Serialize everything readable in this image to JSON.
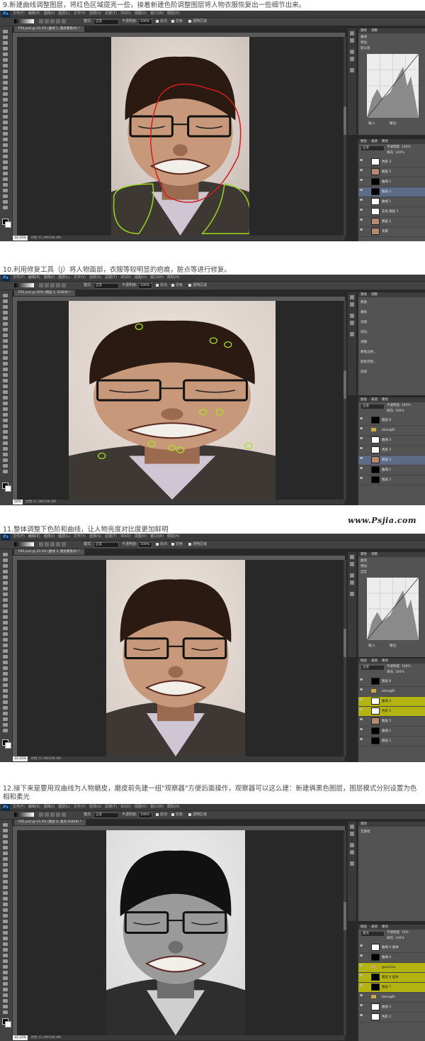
{
  "steps": [
    {
      "caption": "9.新建曲线调整图层，将红色区域提亮一些，接着新建色阶调整图层将人物衣服恢复出一些细节出来。"
    },
    {
      "caption": "10.利用修复工具（J）将人物面部，衣服等较明显的疤痕，脏点等进行修复。"
    },
    {
      "caption": "11.整体调整下色阶和曲线，让人物亮度对比度更加鲜明"
    },
    {
      "caption": "12.接下来是要用双曲线为人物磨皮，磨皮前先建一组\"观察器\"方便后面操作，观察器可以这么建：新建俩黑色图层，图层模式分别设置为色相和柔光"
    }
  ],
  "watermark": "www.Psjia.com",
  "photoshop": {
    "logo": "Ps",
    "options": {
      "mode_label": "模式:",
      "mode_value": "正常",
      "opacity_label": "不透明度:",
      "opacity_value": "100%",
      "reverse": "反向",
      "dither": "仿色",
      "transparency": "透明区域"
    },
    "windows": [
      {
        "tab": "PS5.psd @ 33.3% (曲线 1, 图层蒙板/8) *",
        "status_zoom": "33.33%",
        "status_doc": "文档:11.2M/106.4M",
        "panel_tabs": [
          "属性",
          "调整"
        ],
        "panel_rows": [
          "曲线",
          "预设:",
          "默认值"
        ],
        "panel_footer": [
          "输入:",
          "输出:"
        ],
        "layer_tabs": [
          "图层",
          "通道",
          "路径"
        ],
        "blend": "正常",
        "layer_opacity": "不透明度: 100%",
        "fill": "填充: 100%",
        "layers": [
          {
            "name": "色阶 2",
            "thumb": "white",
            "state": ""
          },
          {
            "name": "图层 5",
            "thumb": "face",
            "state": ""
          },
          {
            "name": "曲线 1",
            "thumb": "black",
            "state": ""
          },
          {
            "name": "图层 1",
            "thumb": "black",
            "state": "sel"
          },
          {
            "name": "曲线 1",
            "thumb": "white",
            "state": ""
          },
          {
            "name": "去色 图层 1",
            "thumb": "white",
            "state": ""
          },
          {
            "name": "图层 2",
            "thumb": "face",
            "state": ""
          },
          {
            "name": "背景",
            "thumb": "face",
            "state": ""
          }
        ]
      },
      {
        "tab": "PS5.psd @ 50% (图层 5, RGB/8) *",
        "status_zoom": "50%",
        "status_doc": "文档:11.2M/106.4M",
        "panel_tabs": [
          "属性",
          "调整"
        ],
        "panel_rows": [
          "像素",
          "蒙板",
          "浓度:",
          "羽化:",
          "调整:",
          "蒙板边缘...",
          "颜色范围...",
          "反相"
        ],
        "panel_footer": [],
        "layer_tabs": [
          "图层",
          "通道",
          "路径"
        ],
        "blend": "正常",
        "layer_opacity": "不透明度: 100%",
        "fill": "填充: 100%",
        "layers": [
          {
            "name": "图层 6",
            "thumb": "black",
            "state": ""
          },
          {
            "name": "zhengfit",
            "thumb": "folder",
            "state": ""
          },
          {
            "name": "曲线 3",
            "thumb": "white",
            "state": ""
          },
          {
            "name": "色阶 2",
            "thumb": "white",
            "state": ""
          },
          {
            "name": "图层 5",
            "thumb": "face",
            "state": "sel"
          },
          {
            "name": "曲线 1",
            "thumb": "black",
            "state": ""
          },
          {
            "name": "图层 1",
            "thumb": "black",
            "state": ""
          }
        ]
      },
      {
        "tab": "PS5.psd @ 33.3% (曲线 3, 图层蒙板/8) *",
        "status_zoom": "33.33%",
        "status_doc": "文档:11.2M/106.4M",
        "panel_tabs": [
          "属性",
          "调整"
        ],
        "panel_rows": [
          "曲线",
          "预设:",
          "自定"
        ],
        "panel_footer": [
          "输入:",
          "输出:"
        ],
        "layer_tabs": [
          "图层",
          "通道",
          "路径"
        ],
        "blend": "正常",
        "layer_opacity": "不透明度: 100%",
        "fill": "填充: 100%",
        "layers": [
          {
            "name": "图层 6",
            "thumb": "black",
            "state": ""
          },
          {
            "name": "zhengfit",
            "thumb": "folder",
            "state": ""
          },
          {
            "name": "曲线 3",
            "thumb": "white",
            "state": "hl"
          },
          {
            "name": "色阶 2",
            "thumb": "white",
            "state": "hl"
          },
          {
            "name": "图层 5",
            "thumb": "face",
            "state": ""
          },
          {
            "name": "曲线 1",
            "thumb": "black",
            "state": ""
          },
          {
            "name": "图层 1",
            "thumb": "black",
            "state": ""
          }
        ]
      },
      {
        "tab": "PS5.psd @ 33.3% (图层 8, 柔光 RGB/8) *",
        "status_zoom": "33.33%",
        "status_doc": "文档:11.2M/106.4M",
        "panel_tabs": [
          "属性"
        ],
        "panel_rows": [
          "无属性"
        ],
        "panel_footer": [],
        "layer_tabs": [
          "图层",
          "通道",
          "路径"
        ],
        "blend": "柔光",
        "layer_opacity": "不透明度: 70%",
        "fill": "填充: 100%",
        "layers": [
          {
            "name": "曲线 4 副本",
            "thumb": "white",
            "state": ""
          },
          {
            "name": "曲线 4",
            "thumb": "black",
            "state": ""
          },
          {
            "name": "guancha",
            "thumb": "folder",
            "state": "hl"
          },
          {
            "name": "图层 8 副本",
            "thumb": "black",
            "state": "hl"
          },
          {
            "name": "图层 7",
            "thumb": "black",
            "state": "hl"
          },
          {
            "name": "zhengfit",
            "thumb": "folder",
            "state": ""
          },
          {
            "name": "曲线 3",
            "thumb": "white",
            "state": ""
          },
          {
            "name": "色阶 2",
            "thumb": "white",
            "state": ""
          }
        ]
      }
    ],
    "menu": [
      "文件(F)",
      "编辑(E)",
      "图像(I)",
      "图层(L)",
      "文字(Y)",
      "选择(S)",
      "滤镜(T)",
      "3D(D)",
      "视图(V)",
      "窗口(W)",
      "帮助(H)"
    ]
  }
}
